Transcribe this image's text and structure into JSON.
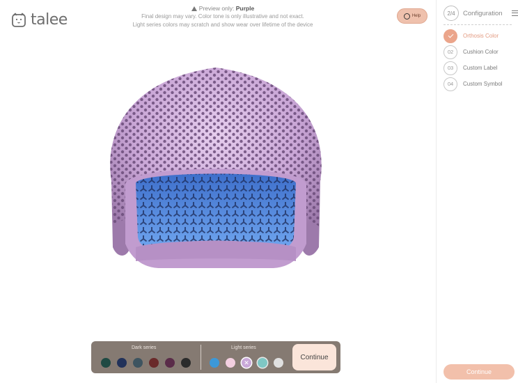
{
  "brand": {
    "name": "talee"
  },
  "notice": {
    "prefix": "Preview only:",
    "color": "Purple",
    "line2": "Final design may vary. Color tone is only illustrative and not exact.",
    "line3": "Light series colors may scratch and show wear over lifetime of the device"
  },
  "help": {
    "label": "Help"
  },
  "sidebar": {
    "step_counter": "2/4",
    "title": "Configuration",
    "steps": [
      {
        "num": "",
        "label": "Orthosis Color",
        "status": "done"
      },
      {
        "num": "02",
        "label": "Cushion Color",
        "status": "pending"
      },
      {
        "num": "03",
        "label": "Custom Label",
        "status": "pending"
      },
      {
        "num": "04",
        "label": "Custom Symbol",
        "status": "pending"
      }
    ],
    "continue_label": "Continue"
  },
  "picker": {
    "dark_label": "Dark series",
    "light_label": "Light series",
    "continue_label": "Continue",
    "dark_swatches": [
      "#1f4a43",
      "#22325a",
      "#3e5460",
      "#6a2a2a",
      "#5a2c49",
      "#2b2b2b"
    ],
    "light_swatches": [
      "#3c98d8",
      "#f3cfe0",
      "#c9a8d8",
      "#7fc7c4",
      "#e0e0e0"
    ],
    "selected_swatch": "Purple"
  },
  "colors": {
    "accent": "#eba58b",
    "helmet_shell": "#c7a3d3",
    "cushion": "#4b7fd8"
  }
}
